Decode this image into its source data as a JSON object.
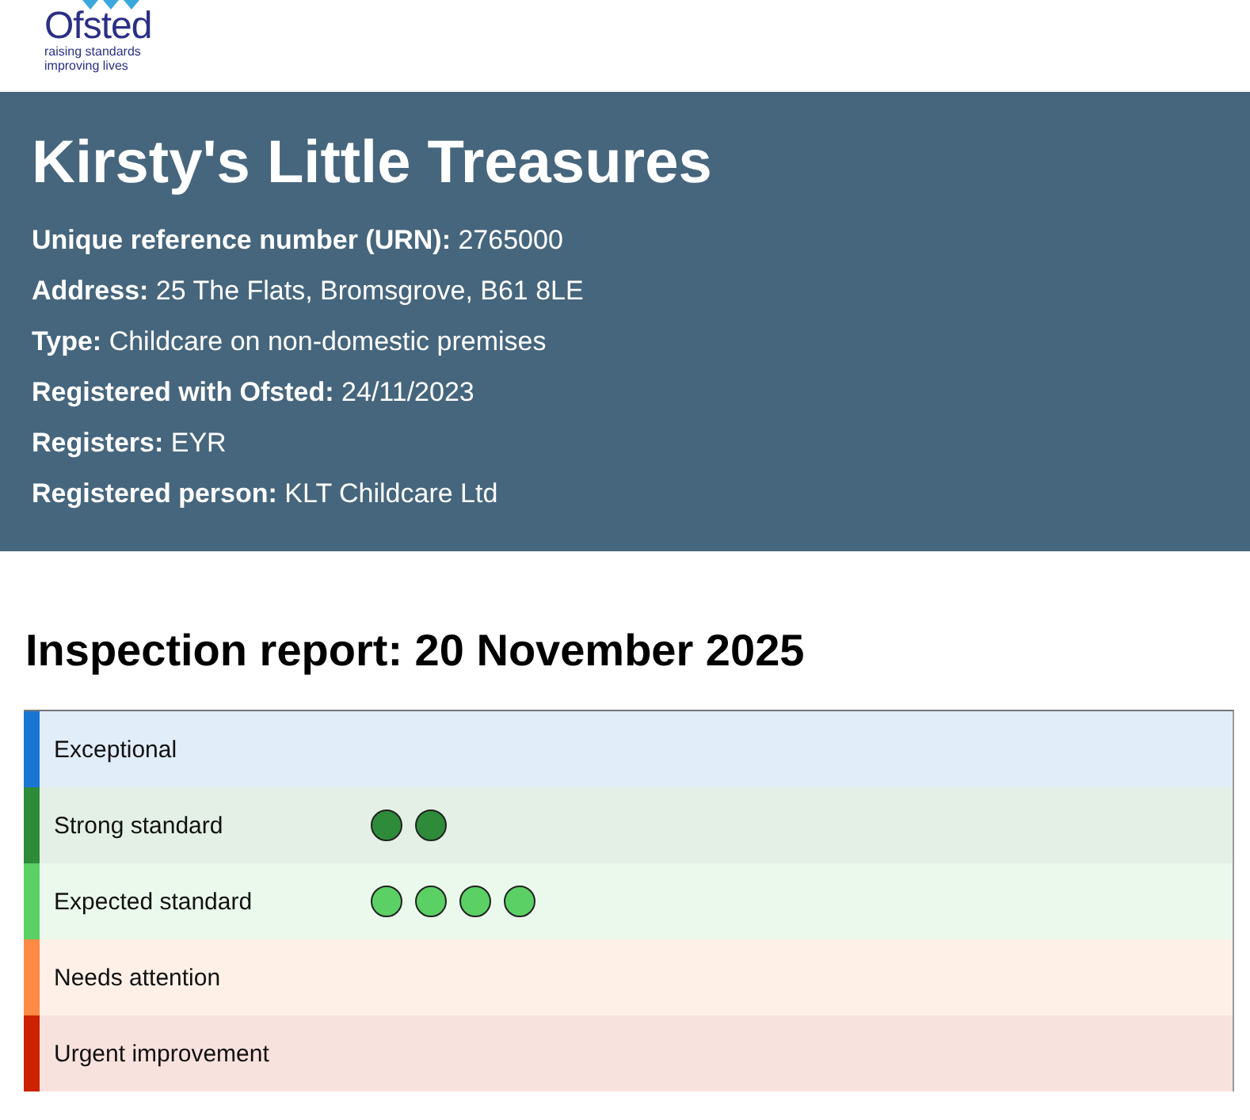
{
  "logo": {
    "name": "Ofsted",
    "tagline": [
      "raising standards",
      "improving lives"
    ]
  },
  "provider": {
    "name": "Kirsty's Little Treasures",
    "details": [
      {
        "label": "Unique reference number (URN):",
        "value": "2765000"
      },
      {
        "label": "Address:",
        "value": "25 The Flats, Bromsgrove, B61 8LE"
      },
      {
        "label": "Type:",
        "value": "Childcare on non-domestic premises"
      },
      {
        "label": "Registered with Ofsted:",
        "value": "24/11/2023"
      },
      {
        "label": "Registers:",
        "value": "EYR"
      },
      {
        "label": "Registered person:",
        "value": "KLT Childcare Ltd"
      }
    ]
  },
  "report": {
    "title": "Inspection report: 20 November 2025",
    "grades": [
      {
        "label": "Exceptional",
        "color": "#1976d2"
      },
      {
        "label": "Strong standard",
        "color": "#2e8b3a",
        "dots": [
          {
            "color": "#2e8b3a"
          },
          {
            "color": "#2e8b3a"
          }
        ]
      },
      {
        "label": "Expected standard",
        "color": "#5bd065",
        "dots": [
          {
            "color": "#5bd065"
          },
          {
            "color": "#5bd065"
          },
          {
            "color": "#5bd065"
          },
          {
            "color": "#5bd065"
          }
        ]
      },
      {
        "label": "Needs attention",
        "color": "#ff8a45"
      },
      {
        "label": "Urgent improvement",
        "color": "#cc2200"
      }
    ]
  }
}
